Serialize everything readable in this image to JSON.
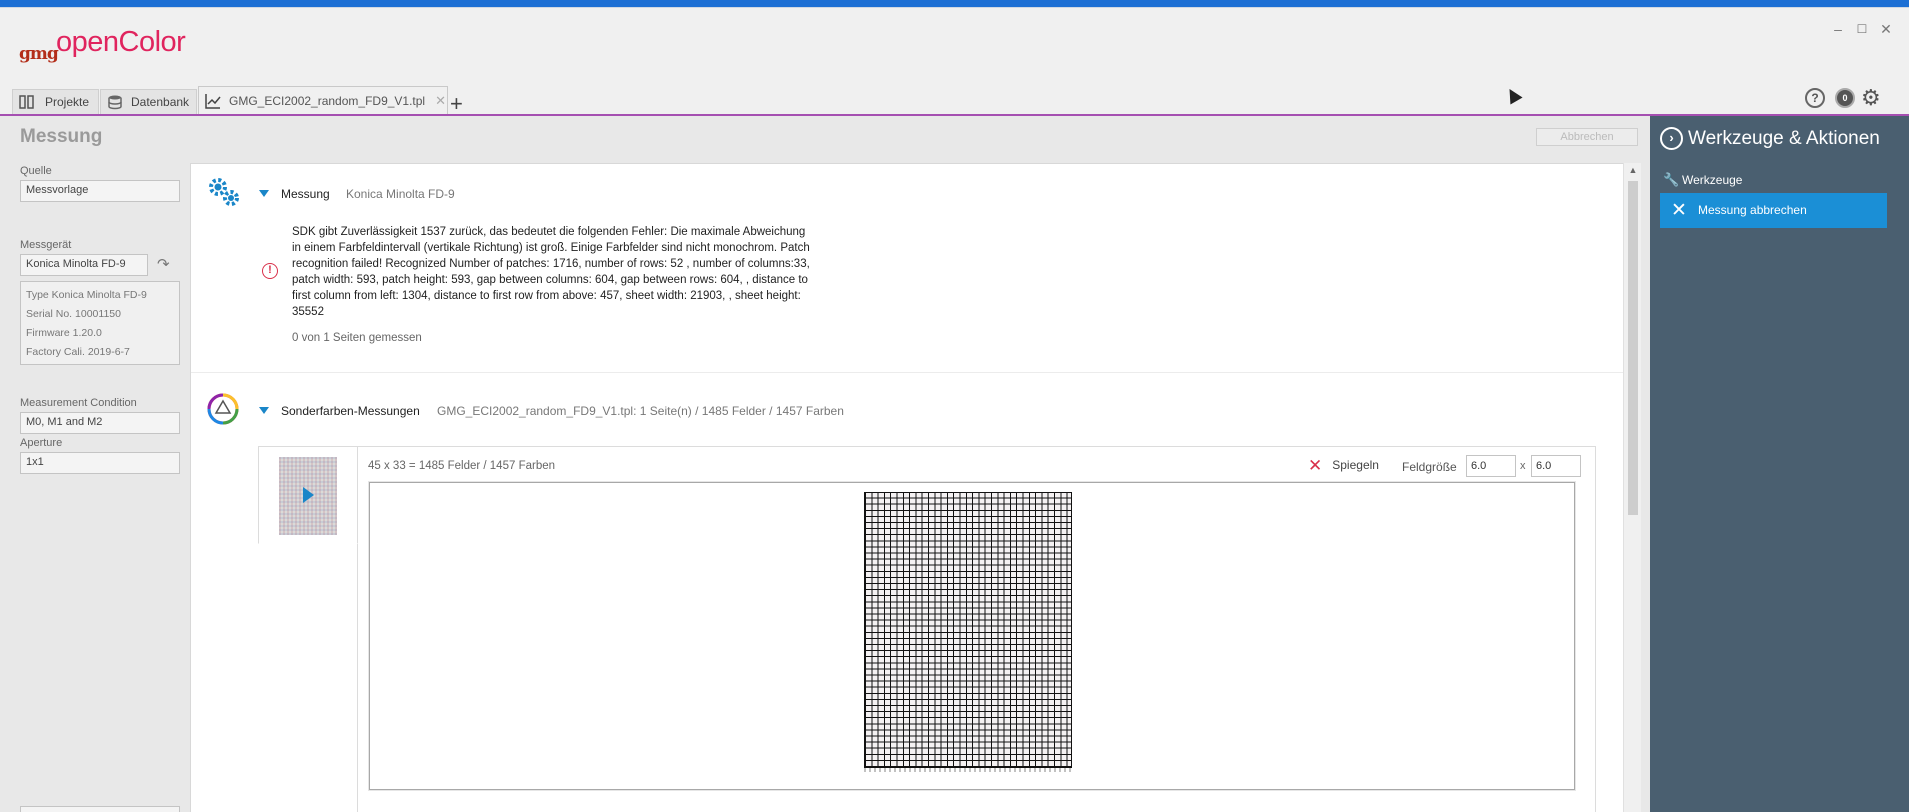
{
  "app": {
    "logo_gmg": "gmg",
    "logo_name": "openColor"
  },
  "window_controls": {
    "minimize": "–",
    "maximize": "☐",
    "close": "✕"
  },
  "tabs": [
    {
      "label": "Projekte"
    },
    {
      "label": "Datenbank"
    },
    {
      "label": "GMG_ECI2002_random_FD9_V1.tpl",
      "active": true,
      "close": "✕"
    }
  ],
  "add_tab": "+",
  "top_icons": {
    "help": "?",
    "badge": "0",
    "settings": "⚙"
  },
  "left": {
    "title": "Messung",
    "source_label": "Quelle",
    "source_value": "Messvorlage",
    "device_label": "Messgerät",
    "device_value": "Konica Minolta FD-9",
    "device_info": [
      "Type Konica Minolta FD-9",
      "Serial No. 10001150",
      "Firmware 1.20.0",
      "Factory Cali. 2019-6-7"
    ],
    "condition_label": "Measurement Condition",
    "condition_value": "M0, M1 and M2",
    "aperture_label": "Aperture",
    "aperture_value": "1x1"
  },
  "main": {
    "cancel_button": "Abbrechen",
    "measurement": {
      "title": "Messung",
      "device": "Konica Minolta FD-9",
      "error": "SDK gibt Zuverlässigkeit 1537 zurück, das bedeutet die folgenden Fehler:  Die maximale Abweichung in einem Farbfeldintervall (vertikale Richtung) ist groß.  Einige Farbfelder sind nicht monochrom.  Patch recognition failed! Recognized Number of patches: 1716, number of rows: 52 , number of columns:33, patch width: 593, patch height: 593, gap between columns: 604, gap between rows: 604, , distance to first column from left: 1304, distance to first row from above: 457, sheet width: 21903, , sheet height: 35552",
      "pages": "0 von 1 Seiten gemessen"
    },
    "spot": {
      "title": "Sonderfarben-Messungen",
      "desc": "GMG_ECI2002_random_FD9_V1.tpl: 1 Seite(n) / 1485 Felder / 1457 Farben",
      "field_info": "45 x 33 = 1485 Felder / 1457 Farben",
      "mirror_label": "Spiegeln",
      "field_size_label": "Feldgröße",
      "field_w": "6.0",
      "field_sep": "x",
      "field_h": "6.0"
    }
  },
  "right": {
    "title": "Werkzeuge & Aktionen",
    "tools_label": "Werkzeuge",
    "action_label": "Messung abbrechen"
  },
  "colors": {
    "accent_purple": "#a54fb1",
    "brand_pink": "#e0245e",
    "action_blue": "#1b8fd6",
    "right_panel": "#4a5f70",
    "error_red": "#d9304a"
  }
}
